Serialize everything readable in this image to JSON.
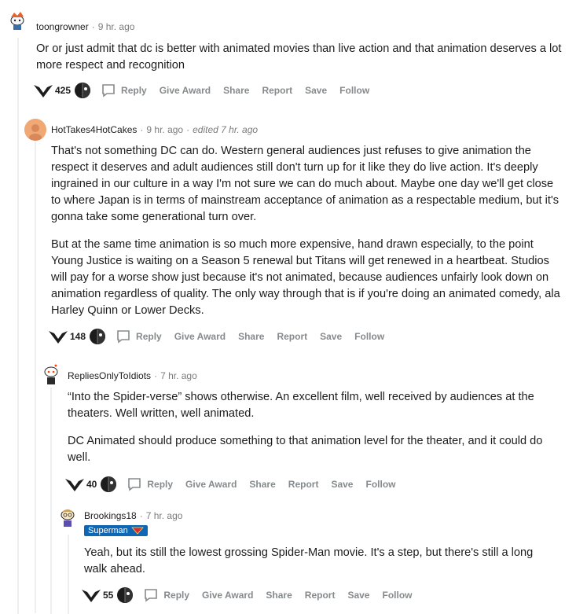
{
  "comments": [
    {
      "author": "toongrowner",
      "time": "9 hr. ago",
      "paragraphs": [
        "Or or just admit that dc is better with animated movies than live action and that animation deserves a lot more respect and recognition"
      ],
      "score": "425",
      "actions": {
        "reply": "Reply",
        "give_award": "Give Award",
        "share": "Share",
        "report": "Report",
        "save": "Save",
        "follow": "Follow"
      }
    },
    {
      "author": "HotTakes4HotCakes",
      "time": "9 hr. ago",
      "edited": "edited 7 hr. ago",
      "paragraphs": [
        "That's not something DC can do. Western general audiences just refuses to give animation the respect it deserves and adult audiences still don't turn up for it like they do live action. It's deeply ingrained in our culture in a way I'm not sure we can do much about. Maybe one day we'll get close to where Japan is in terms of mainstream acceptance of animation as a respectable medium, but it's gonna take some generational turn over.",
        "But at the same time animation is so much more expensive, hand drawn especially, to the point Young Justice is waiting on a Season 5 renewal but Titans will get renewed in a heartbeat. Studios will pay for a worse show just because it's not animated, because audiences unfairly look down on animation regardless of quality. The only way through that is if you're doing an animated comedy, ala Harley Quinn or Lower Decks."
      ],
      "score": "148",
      "actions": {
        "reply": "Reply",
        "give_award": "Give Award",
        "share": "Share",
        "report": "Report",
        "save": "Save",
        "follow": "Follow"
      }
    },
    {
      "author": "RepliesOnlyToIdiots",
      "time": "7 hr. ago",
      "paragraphs": [
        "“Into the Spider-verse” shows otherwise. An excellent film, well received by audiences at the theaters. Well written, well animated.",
        "DC Animated should produce something to that animation level for the theater, and it could do well."
      ],
      "score": "40",
      "actions": {
        "reply": "Reply",
        "give_award": "Give Award",
        "share": "Share",
        "report": "Report",
        "save": "Save",
        "follow": "Follow"
      }
    },
    {
      "author": "Brookings18",
      "time": "7 hr. ago",
      "flair": "Superman",
      "paragraphs": [
        "Yeah, but its still the lowest grossing Spider-Man movie. It's a step, but there's still a long walk ahead."
      ],
      "score": "55",
      "actions": {
        "reply": "Reply",
        "give_award": "Give Award",
        "share": "Share",
        "report": "Report",
        "save": "Save",
        "follow": "Follow"
      }
    }
  ],
  "colors": {
    "meta": "#7c7c7c",
    "action": "#878a8c",
    "thread_line": "#edeff1",
    "flair_bg": "#0d67b5"
  }
}
